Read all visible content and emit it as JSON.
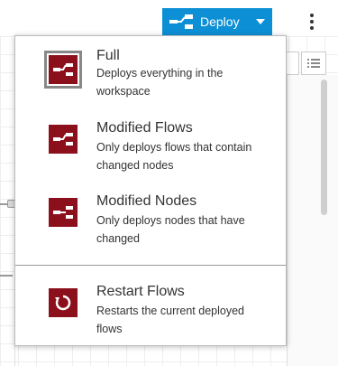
{
  "header": {
    "deploy_label": "Deploy"
  },
  "menu": {
    "items": [
      {
        "title": "Full",
        "description": "Deploys everything in the workspace",
        "icon": "deploy-full-icon"
      },
      {
        "title": "Modified Flows",
        "description": "Only deploys flows that contain changed nodes",
        "icon": "deploy-flows-icon"
      },
      {
        "title": "Modified Nodes",
        "description": "Only deploys nodes that have changed",
        "icon": "deploy-nodes-icon"
      },
      {
        "title": "Restart Flows",
        "description": "Restarts the current deployed flows",
        "icon": "restart-icon"
      }
    ]
  },
  "colors": {
    "deploy_button": "#0d8fd6",
    "menu_icon": "#8c101c"
  }
}
